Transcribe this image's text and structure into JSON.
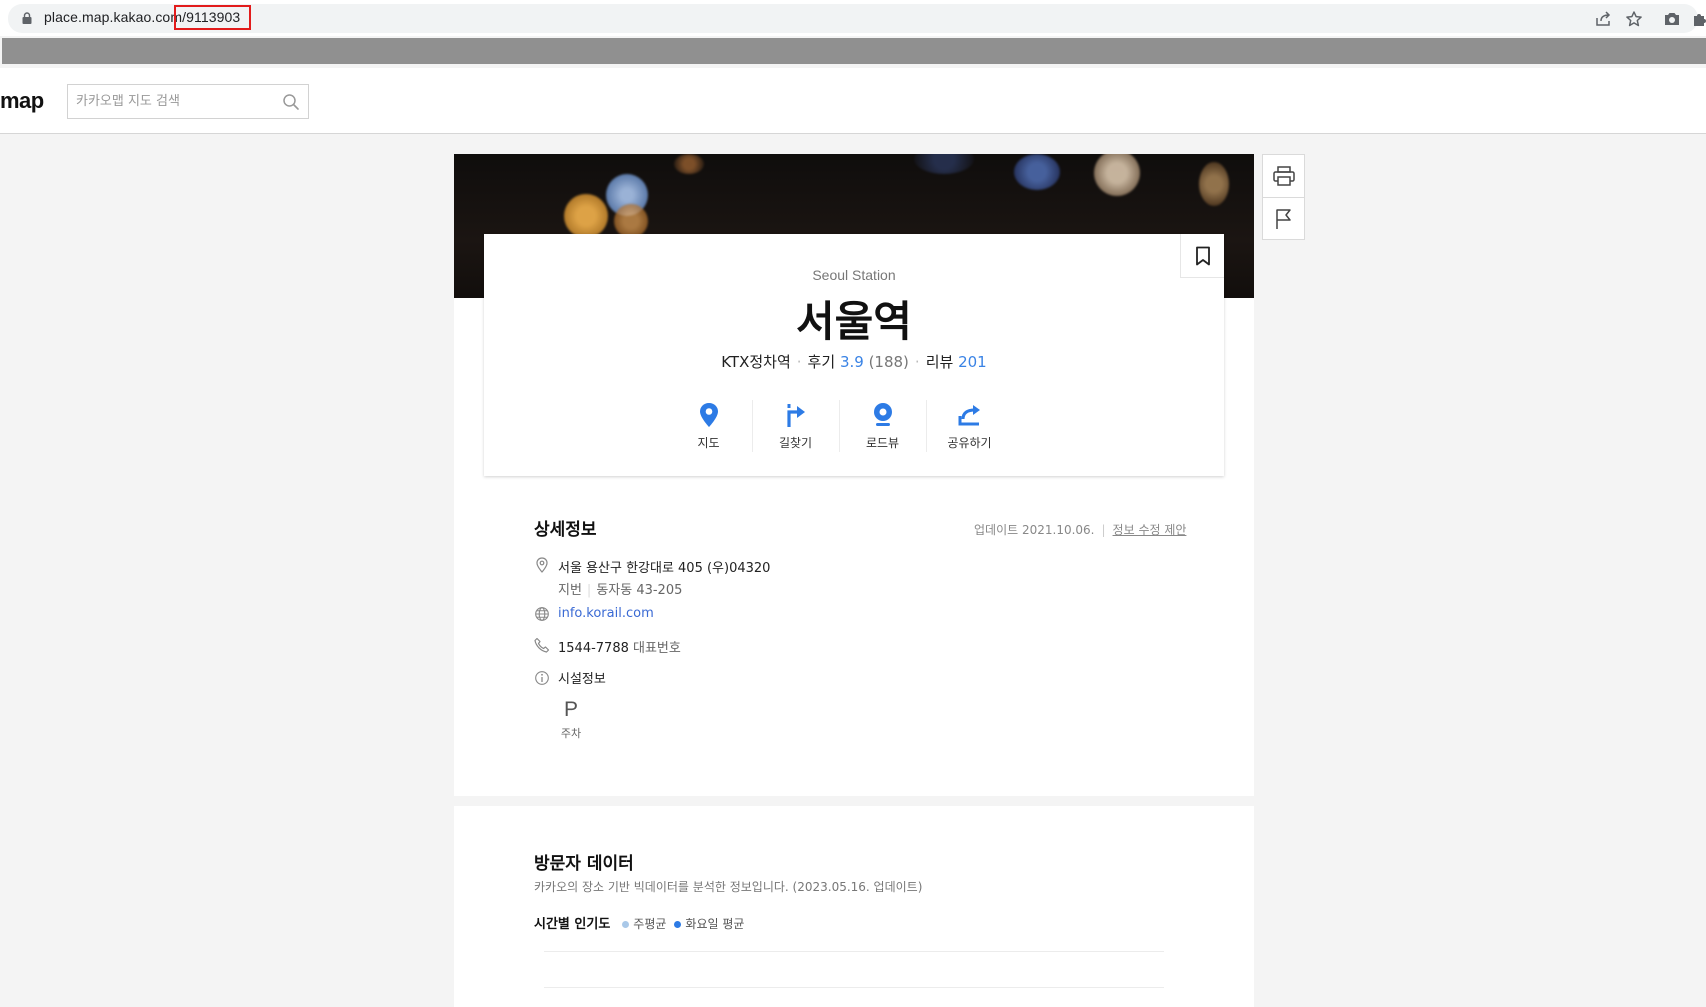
{
  "browser": {
    "url_host": "place.map.kakao.com",
    "url_path": "/9113903"
  },
  "header": {
    "logo": "map",
    "search_placeholder": "카카오맵 지도 검색"
  },
  "place": {
    "english_name": "Seoul Station",
    "name": "서울역",
    "category": "KTX정차역",
    "review_label": "후기",
    "rating": "3.9",
    "rating_count": "(188)",
    "blog_review_label": "리뷰",
    "blog_review_count": "201"
  },
  "actions": [
    {
      "label": "지도",
      "icon": "map-pin-icon"
    },
    {
      "label": "길찾기",
      "icon": "directions-icon"
    },
    {
      "label": "로드뷰",
      "icon": "roadview-icon"
    },
    {
      "label": "공유하기",
      "icon": "share-icon"
    }
  ],
  "details": {
    "title": "상세정보",
    "update_text": "업데이트 2021.10.06.",
    "suggest_edit": "정보 수정 제안",
    "address": "서울 용산구 한강대로 405 (우)04320",
    "jibun_label": "지번",
    "jibun": "동자동 43-205",
    "homepage": "info.korail.com",
    "phone": "1544-7788",
    "phone_type": "대표번호",
    "facility_label": "시설정보",
    "facilities": [
      {
        "icon": "P",
        "label": "주차"
      }
    ]
  },
  "visitor": {
    "title": "방문자 데이터",
    "description": "카카오의 장소 기반 빅데이터를 분석한 정보입니다. (2023.05.16. 업데이트)",
    "popularity_title": "시간별 인기도",
    "legend_week": "주평균",
    "legend_day": "화요일 평균",
    "legend_week_color": "#a9c8e8",
    "legend_day_color": "#2d7be5"
  },
  "colors": {
    "accent": "#3a83e5",
    "highlight_box": "#e21b1b"
  }
}
